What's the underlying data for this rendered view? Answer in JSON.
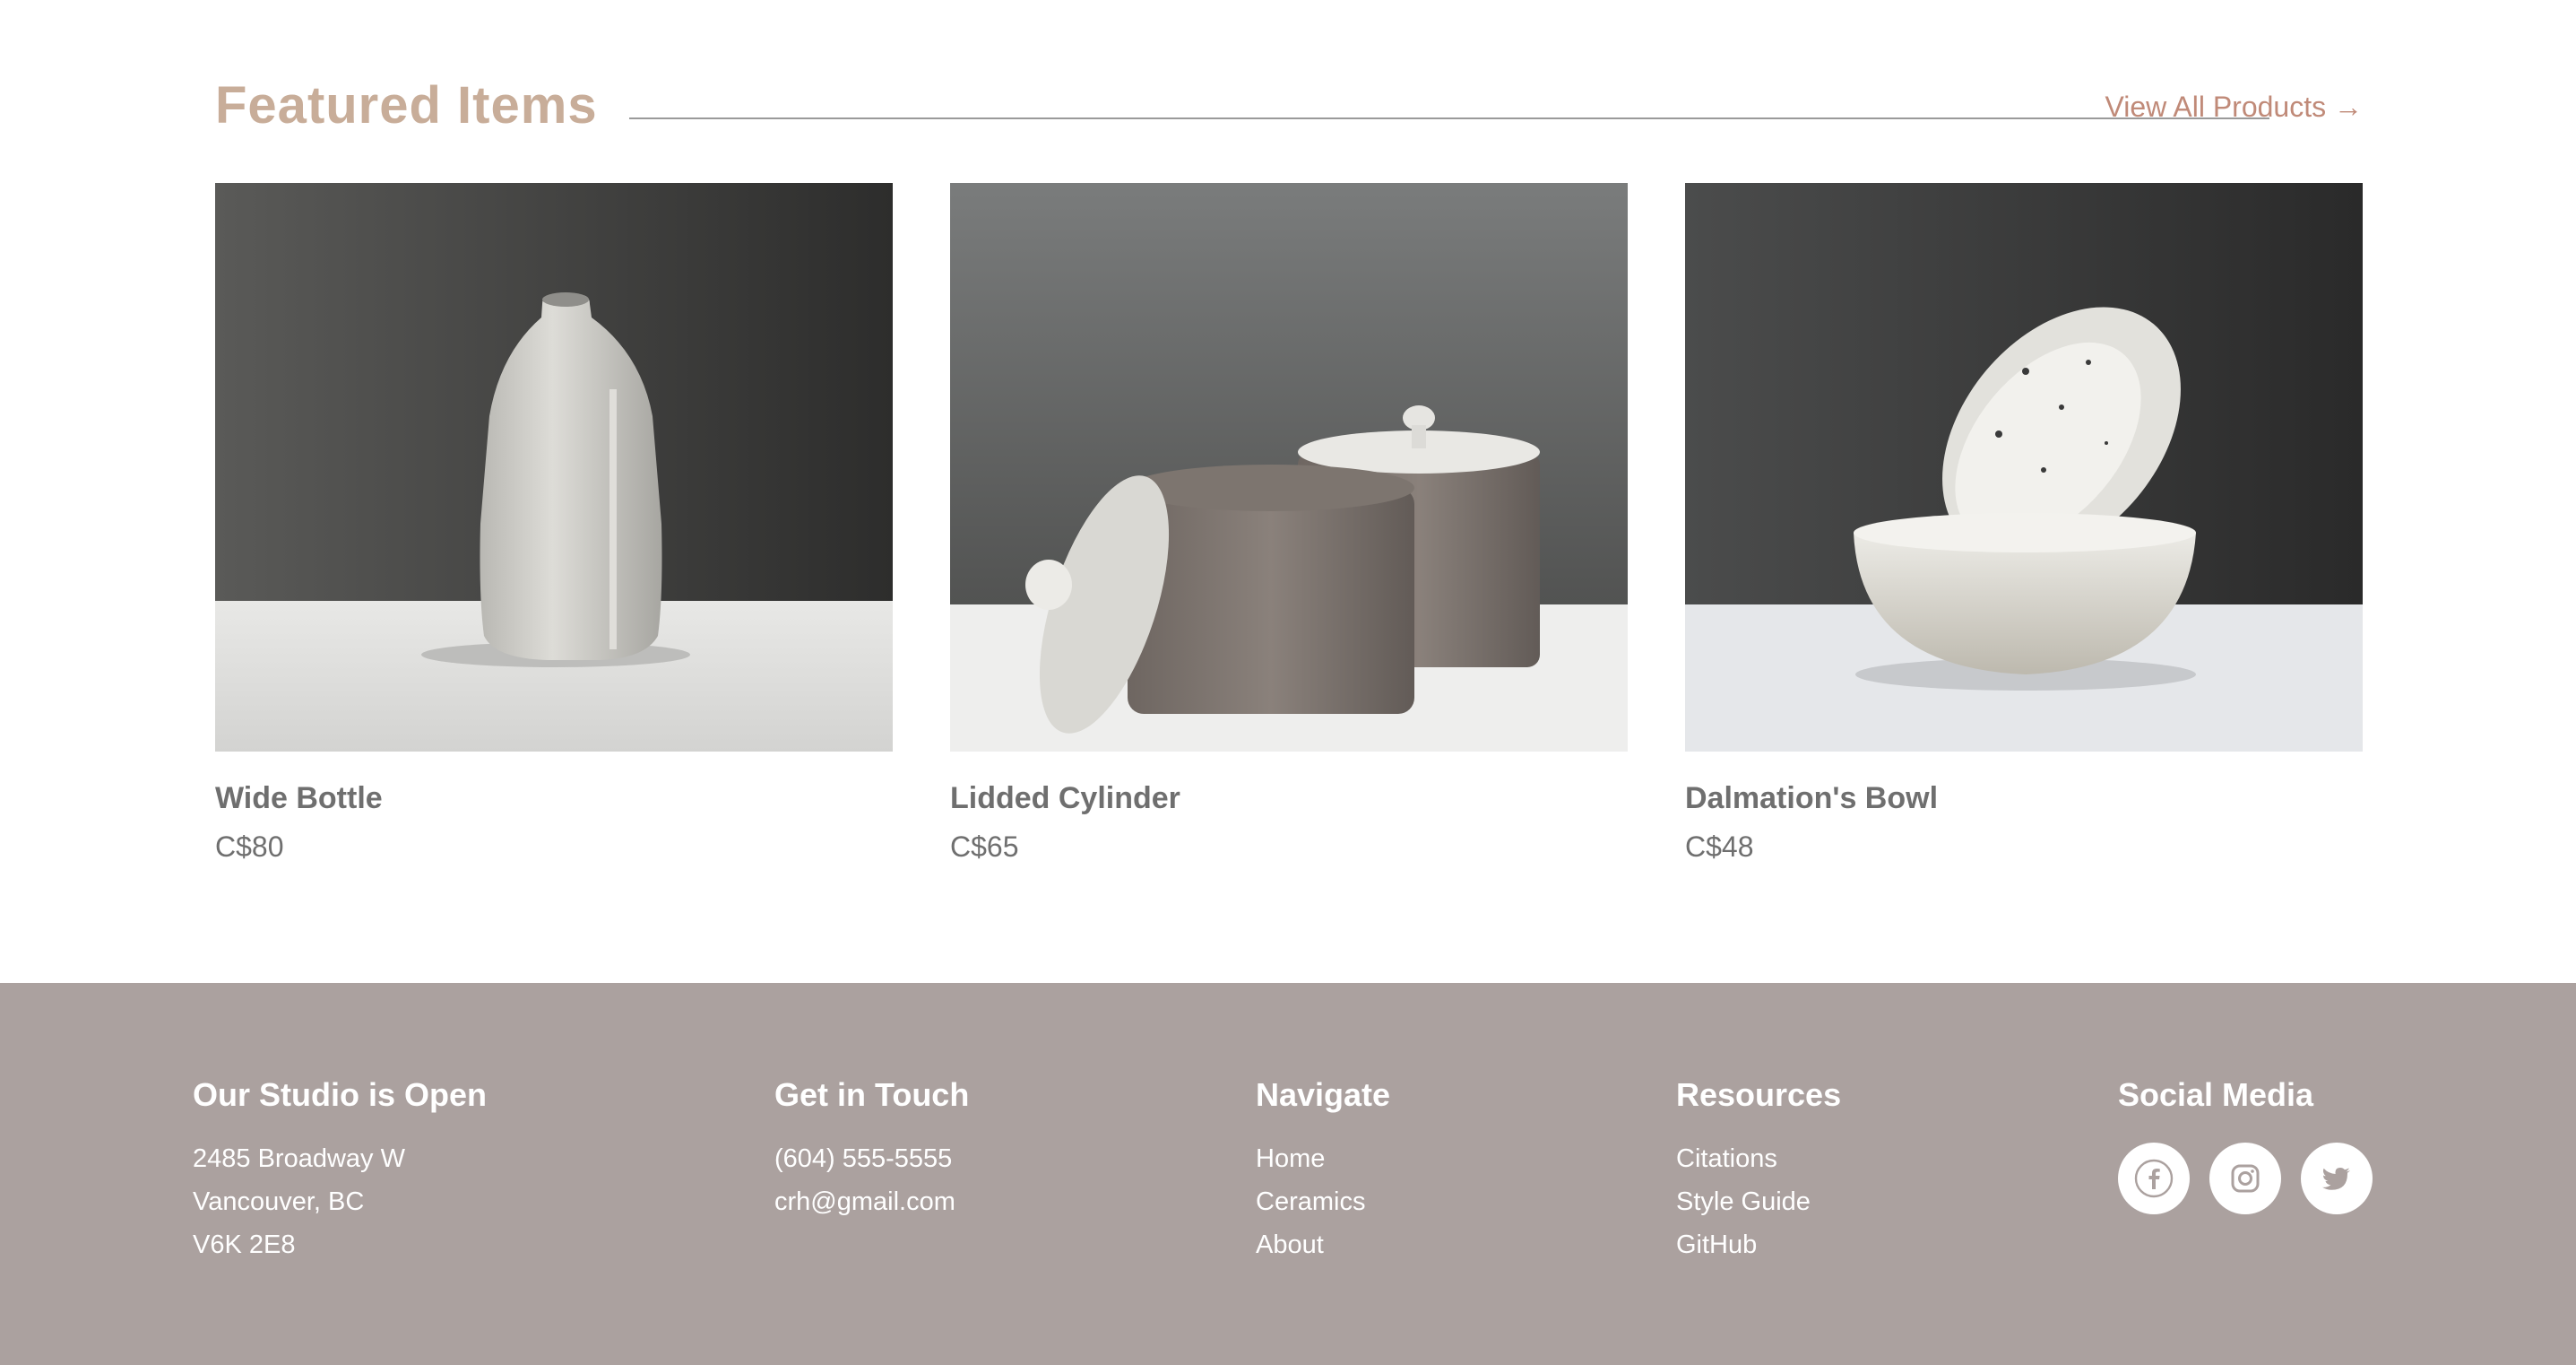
{
  "featured": {
    "title": "Featured Items",
    "view_all": "View All Products →",
    "products": [
      {
        "name": "Wide Bottle",
        "price": "C$80",
        "image": "wide-bottle-photo"
      },
      {
        "name": "Lidded Cylinder",
        "price": "C$65",
        "image": "lidded-cylinder-photo"
      },
      {
        "name": "Dalmation's Bowl",
        "price": "C$48",
        "image": "dalmation-bowl-photo"
      }
    ]
  },
  "footer": {
    "studio": {
      "heading": "Our Studio is Open",
      "lines": [
        "2485 Broadway W",
        "Vancouver, BC",
        "V6K 2E8"
      ]
    },
    "contact": {
      "heading": "Get in Touch",
      "phone": "(604) 555-5555",
      "email": "crh@gmail.com"
    },
    "navigate": {
      "heading": "Navigate",
      "links": [
        "Home",
        "Ceramics",
        "About"
      ]
    },
    "resources": {
      "heading": "Resources",
      "links": [
        "Citations",
        "Style Guide",
        "GitHub"
      ]
    },
    "social": {
      "heading": "Social Media",
      "icons": [
        "facebook-icon",
        "instagram-icon",
        "twitter-icon"
      ]
    }
  },
  "colors": {
    "heading_accent": "#c8ad99",
    "link_accent": "#c08a78",
    "footer_bg": "#aba19f",
    "text_gray": "#6f6f6f"
  }
}
